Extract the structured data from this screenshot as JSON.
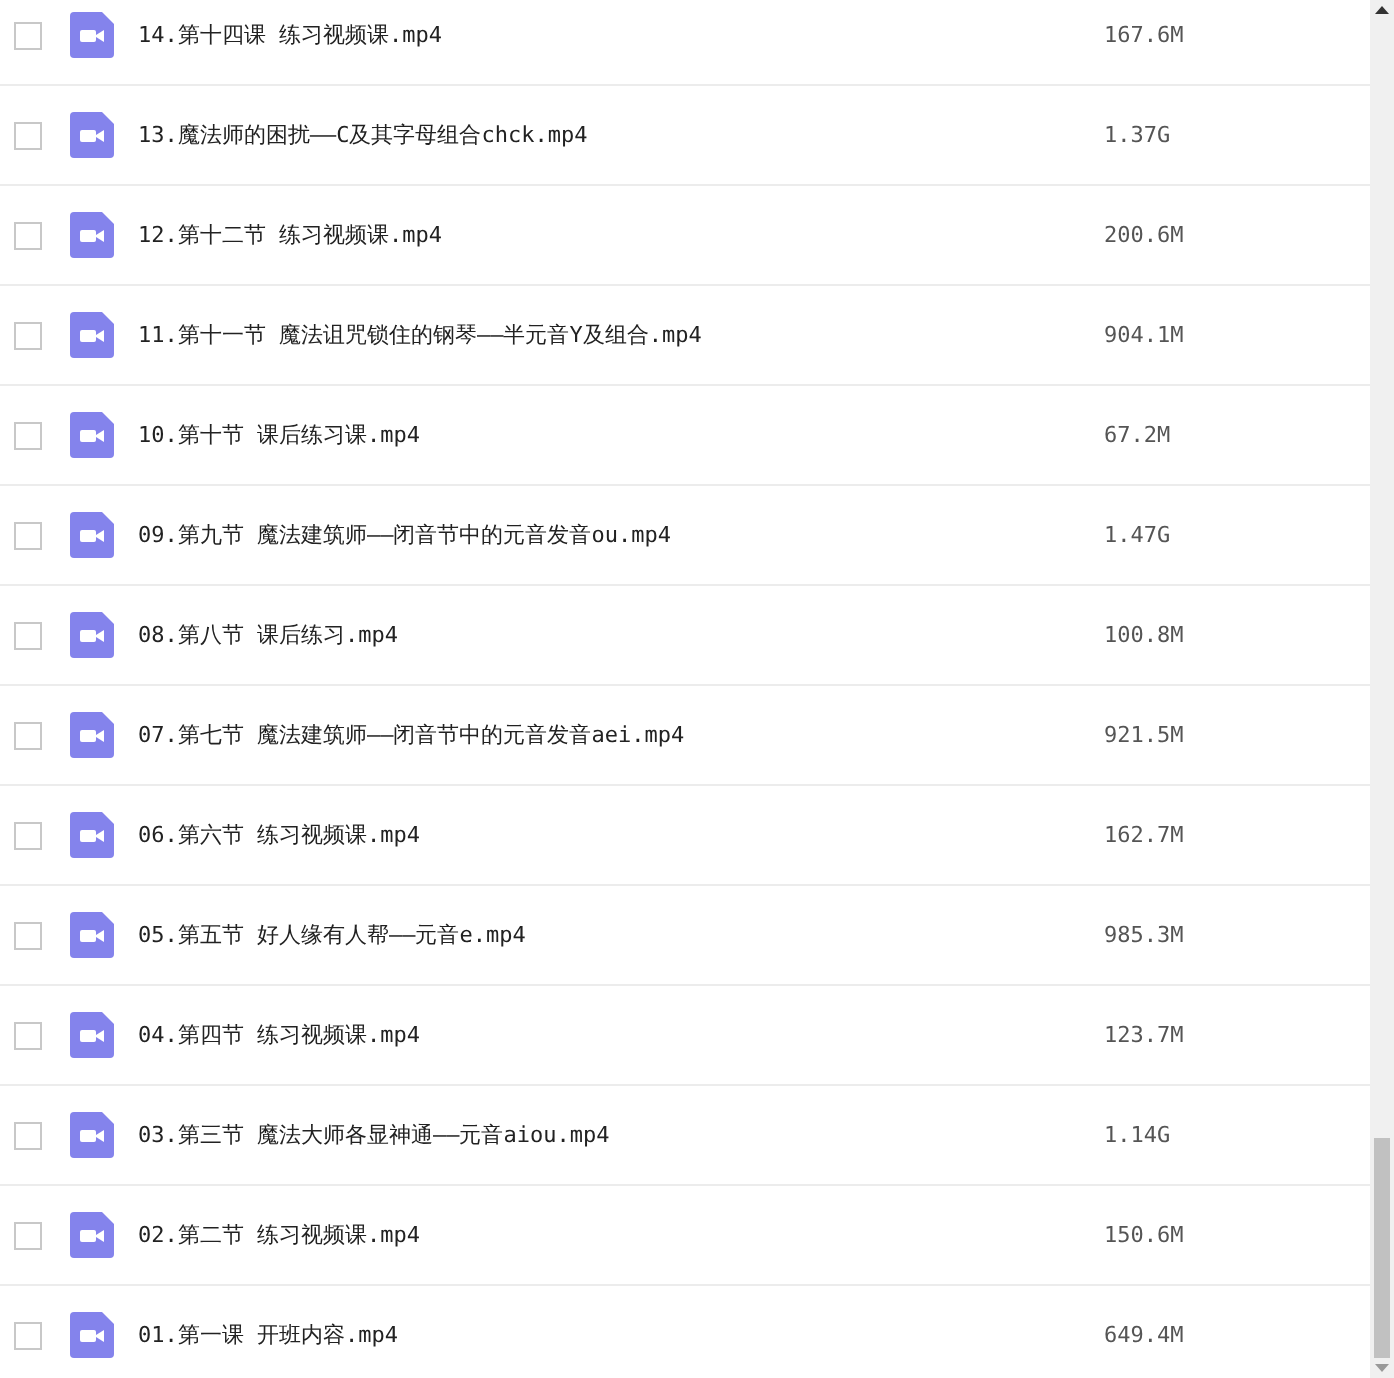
{
  "files": [
    {
      "name": "14.第十四课 练习视频课.mp4",
      "size": "167.6M",
      "checked": false
    },
    {
      "name": "13.魔法师的困扰——C及其字母组合chck.mp4",
      "size": "1.37G",
      "checked": false
    },
    {
      "name": "12.第十二节 练习视频课.mp4",
      "size": "200.6M",
      "checked": false
    },
    {
      "name": "11.第十一节 魔法诅咒锁住的钢琴——半元音Y及组合.mp4",
      "size": "904.1M",
      "checked": false
    },
    {
      "name": "10.第十节 课后练习课.mp4",
      "size": "67.2M",
      "checked": false
    },
    {
      "name": "09.第九节 魔法建筑师——闭音节中的元音发音ou.mp4",
      "size": "1.47G",
      "checked": false
    },
    {
      "name": "08.第八节 课后练习.mp4",
      "size": "100.8M",
      "checked": false
    },
    {
      "name": "07.第七节 魔法建筑师——闭音节中的元音发音aei.mp4",
      "size": "921.5M",
      "checked": false
    },
    {
      "name": "06.第六节 练习视频课.mp4",
      "size": "162.7M",
      "checked": false
    },
    {
      "name": "05.第五节 好人缘有人帮——元音e.mp4",
      "size": "985.3M",
      "checked": false
    },
    {
      "name": "04.第四节 练习视频课.mp4",
      "size": "123.7M",
      "checked": false
    },
    {
      "name": "03.第三节 魔法大师各显神通——元音aiou.mp4",
      "size": "1.14G",
      "checked": false
    },
    {
      "name": "02.第二节 练习视频课.mp4",
      "size": "150.6M",
      "checked": false
    },
    {
      "name": "01.第一课 开班内容.mp4",
      "size": "649.4M",
      "checked": false
    }
  ]
}
